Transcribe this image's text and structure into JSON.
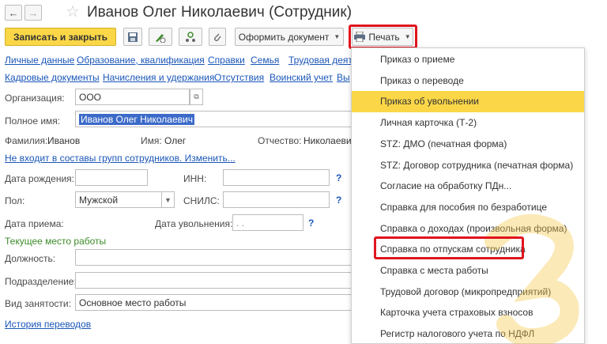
{
  "window": {
    "title": "Иванов Олег Николаевич (Сотрудник)"
  },
  "toolbar": {
    "save_close": "Записать и закрыть",
    "oformit": "Оформить документ",
    "print": "Печать"
  },
  "tabs_row1": [
    "Личные данные",
    "Образование, квалификация",
    "Справки",
    "Семья",
    "Трудовая деят"
  ],
  "tabs_row2": [
    "Кадровые документы",
    "Начисления и удержания",
    "Отсутствия",
    "Воинский учет",
    "Вы"
  ],
  "form": {
    "org_label": "Организация:",
    "org_value": "ООО",
    "fullname_label": "Полное имя:",
    "fullname_value": "Иванов Олег Николаевич",
    "surname_label": "Фамилия:",
    "surname_value": "Иванов",
    "name_label": "Имя:",
    "name_value": "Олег",
    "patronymic_label": "Отчество:",
    "patronymic_value": "Николаевич",
    "groups_link": "Не входит в составы групп сотрудников. Изменить...",
    "birth_label": "Дата рождения:",
    "inn_label": "ИНН:",
    "sex_label": "Пол:",
    "sex_value": "Мужской",
    "snils_label": "СНИЛС:",
    "hire_label": "Дата приема:",
    "fire_label": "Дата увольнения:",
    "fire_value": " .  .",
    "workplace_heading": "Текущее место работы",
    "position_label": "Должность:",
    "dept_label": "Подразделение:",
    "employment_label": "Вид занятости:",
    "employment_value": "Основное место работы",
    "history_link": "История переводов",
    "question": "?"
  },
  "print_menu": {
    "items": [
      "Приказ о приеме",
      "Приказ о переводе",
      "Приказ об увольнении",
      "Личная карточка (Т-2)",
      "STZ: ДМО (печатная форма)",
      "STZ: Договор сотрудника (печатная форма)",
      "Согласие на обработку ПДн...",
      "Справка для пособия по безработице",
      "Справка о доходах (произвольная форма)",
      "Справка по отпускам сотрудника",
      "Справка с места работы",
      "Трудовой договор (микропредприятий)",
      "Карточка учета страховых взносов",
      "Регистр налогового учета по НДФЛ"
    ],
    "active_index": 2,
    "highlighted_index": 9
  },
  "colors": {
    "accent_yellow": "#fbd748",
    "highlight_red": "#e0141d",
    "link_blue": "#1a56b8"
  }
}
